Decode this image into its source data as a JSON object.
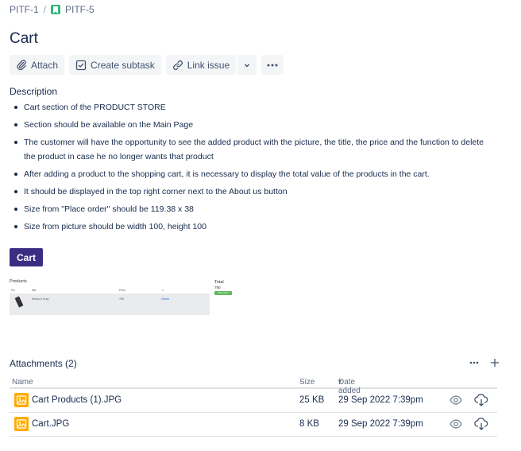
{
  "breadcrumb": {
    "parent": "PITF-1",
    "separator": "/",
    "current": "PITF-5"
  },
  "issue": {
    "title": "Cart"
  },
  "toolbar": {
    "attach": "Attach",
    "create_subtask": "Create subtask",
    "link_issue": "Link issue"
  },
  "description": {
    "label": "Description",
    "items": [
      "Cart section of the PRODUCT STORE",
      "Section should be available on the Main Page",
      "The customer will have the opportunity to see the added product with the picture, the title, the price and the function to delete the product in case he no longer wants that product",
      "After adding a product to the shopping cart, it is necessary to display the total value of the products in the cart.",
      "It should be displayed in the top right corner next to the About us button",
      "Size from \"Place order\" should be 119.38 x 38",
      "Size from picture should be width 100, height 100"
    ],
    "cart_image_label": "Cart",
    "products_image": {
      "title": "Products",
      "col_pic": "Pic",
      "col_title": "title",
      "col_price": "Price",
      "col_x": "x",
      "row_title": "Nexus 6 Gray",
      "row_price": "790",
      "row_delete": "Delete",
      "total_label": "Total",
      "total_value": "790",
      "place_order": "Place Order"
    }
  },
  "attachments": {
    "header": "Attachments (2)",
    "columns": {
      "name": "Name",
      "size": "Size",
      "date": "Date added"
    },
    "files": [
      {
        "name": "Cart Products (1).JPG",
        "size": "25 KB",
        "date": "29 Sep 2022 7:39pm"
      },
      {
        "name": "Cart.JPG",
        "size": "8 KB",
        "date": "29 Sep 2022 7:39pm"
      }
    ]
  },
  "colors": {
    "story": "#36b37e",
    "cart_bg": "#3b2d82",
    "file_icon": "#ffab00"
  }
}
